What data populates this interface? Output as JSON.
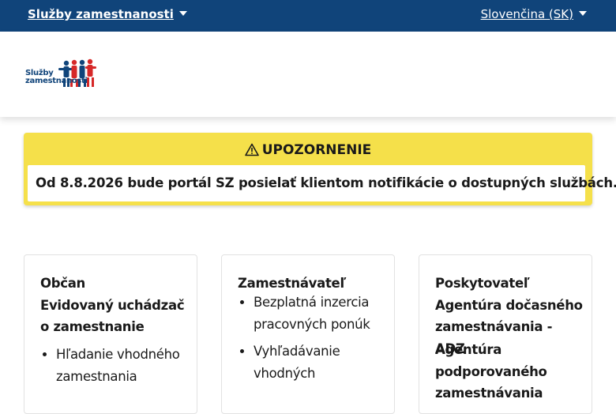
{
  "topbar": {
    "site_menu_label": "Služby zamestnanosti",
    "language_label": "Slovenčina (SK)",
    "background": "#10447a"
  },
  "header": {
    "logo_text_line1": "Služby",
    "logo_text_line2": "zamestnanosti"
  },
  "alert": {
    "title": "UPOZORNENIE",
    "message": "Od 8.8.2026 bude portál SZ posielať klientom notifikácie o dostupných službách.",
    "background": "#f5e04a",
    "icon": "warning-triangle-icon"
  },
  "cards": [
    {
      "title_lines": [
        "Občan",
        "Evidovaný uchádzač o zamestnanie"
      ],
      "items": [
        "Hľadanie vhodného zamestnania"
      ]
    },
    {
      "title_lines": [
        "Zamestnávateľ"
      ],
      "items": [
        "Bezplatná inzercia pracovných ponúk",
        "Vyhľadávanie vhodných"
      ]
    },
    {
      "title_lines": [
        "Poskytovateľ",
        "Agentúra dočasného zamestnávania - ADZ"
      ],
      "subtitle": "Agentúra podporovaného zamestnávania"
    }
  ]
}
